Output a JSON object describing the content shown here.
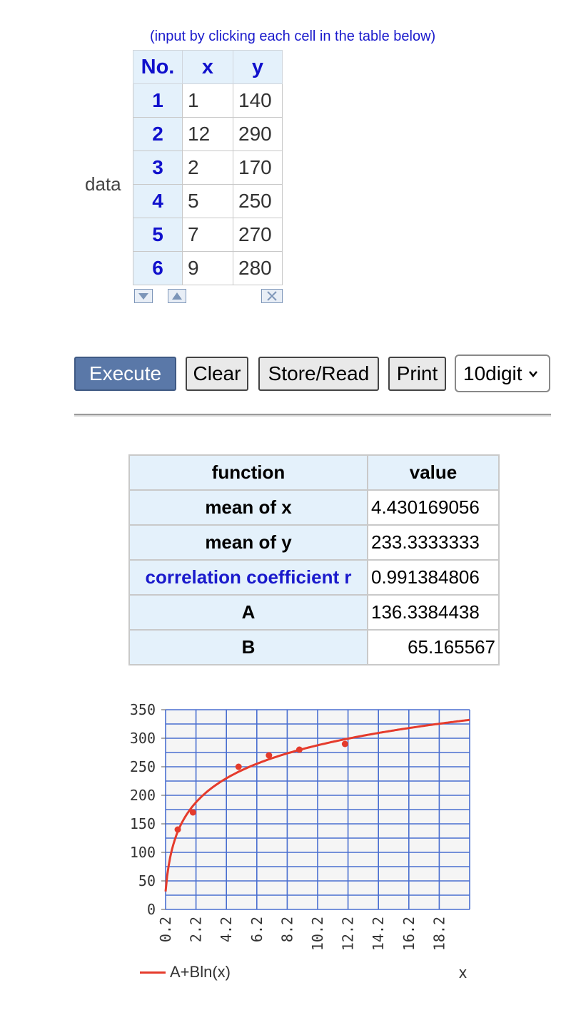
{
  "hint": "(input by clicking each cell in the table below)",
  "data_label": "data",
  "table": {
    "headers": [
      "No.",
      "x",
      "y"
    ],
    "rows": [
      {
        "no": "1",
        "x": "1",
        "y": "140"
      },
      {
        "no": "2",
        "x": "12",
        "y": "290"
      },
      {
        "no": "3",
        "x": "2",
        "y": "170"
      },
      {
        "no": "4",
        "x": "5",
        "y": "250"
      },
      {
        "no": "5",
        "x": "7",
        "y": "270"
      },
      {
        "no": "6",
        "x": "9",
        "y": "280"
      }
    ]
  },
  "buttons": {
    "execute": "Execute",
    "clear": "Clear",
    "store_read": "Store/Read",
    "print": "Print",
    "digits": "10digit"
  },
  "results": {
    "header_function": "function",
    "header_value": "value",
    "rows": [
      {
        "function": "mean of x",
        "value": "4.430169056"
      },
      {
        "function": "mean of y",
        "value": "233.3333333"
      },
      {
        "function": "correlation coefficient r",
        "value": "0.991384806"
      },
      {
        "function": "A",
        "value": "136.3384438"
      },
      {
        "function": "B",
        "value": "65.165567"
      }
    ]
  },
  "chart_data": {
    "type": "scatter",
    "x_ticks": [
      "0.2",
      "2.2",
      "4.2",
      "6.2",
      "8.2",
      "10.2",
      "12.2",
      "14.2",
      "16.2",
      "18.2"
    ],
    "y_ticks": [
      "350",
      "300",
      "250",
      "200",
      "150",
      "100",
      "50",
      "0"
    ],
    "xlim": [
      0.2,
      20.2
    ],
    "ylim": [
      0,
      350
    ],
    "points": [
      {
        "x": 1,
        "y": 140
      },
      {
        "x": 12,
        "y": 290
      },
      {
        "x": 2,
        "y": 170
      },
      {
        "x": 5,
        "y": 250
      },
      {
        "x": 7,
        "y": 270
      },
      {
        "x": 9,
        "y": 280
      }
    ],
    "curve": {
      "A": 136.3384438,
      "B": 65.165567,
      "formula": "A+Bln(x)"
    },
    "legend": "A+Bln(x)",
    "xlabel": "x",
    "grid": true,
    "colors": {
      "grid": "#4a6fd0",
      "curve": "#e53b2c",
      "point": "#e53b2c"
    }
  }
}
